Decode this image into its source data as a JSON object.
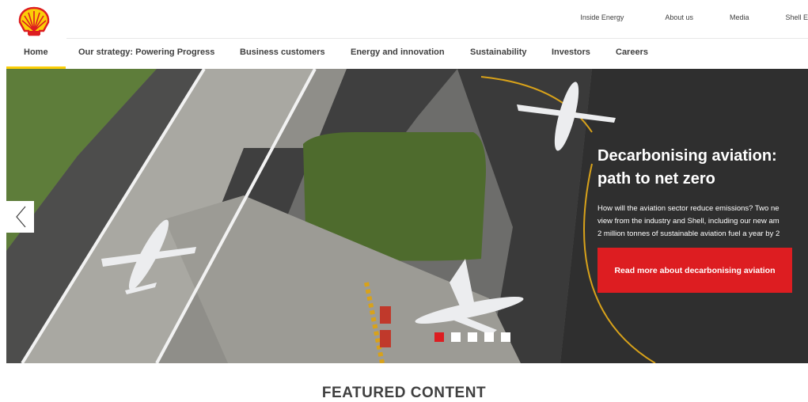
{
  "header": {
    "logo_name": "shell-pecten-logo",
    "utility_links": [
      "Inside Energy",
      "About us",
      "Media",
      "Shell E"
    ]
  },
  "nav": {
    "items": [
      "Home",
      "Our strategy: Powering Progress",
      "Business customers",
      "Energy and innovation",
      "Sustainability",
      "Investors",
      "Careers"
    ],
    "active": "Home"
  },
  "hero": {
    "title_line1": "Decarbonising aviation:",
    "title_line2": "path to net zero",
    "body_line1": "How will the aviation sector reduce emissions? Two ne",
    "body_line2": "view from the industry and Shell, including our new am",
    "body_line3": "2 million tonnes of sustainable aviation fuel a year by 2",
    "cta_label": "Read more about decarbonising aviation",
    "prev_icon": "chevron-left-icon",
    "slides": 5,
    "active_slide": 1
  },
  "featured": {
    "heading": "FEATURED CONTENT"
  },
  "colors": {
    "brand_red": "#dd1d21",
    "brand_yellow": "#fbce07",
    "text_dark": "#404040"
  }
}
